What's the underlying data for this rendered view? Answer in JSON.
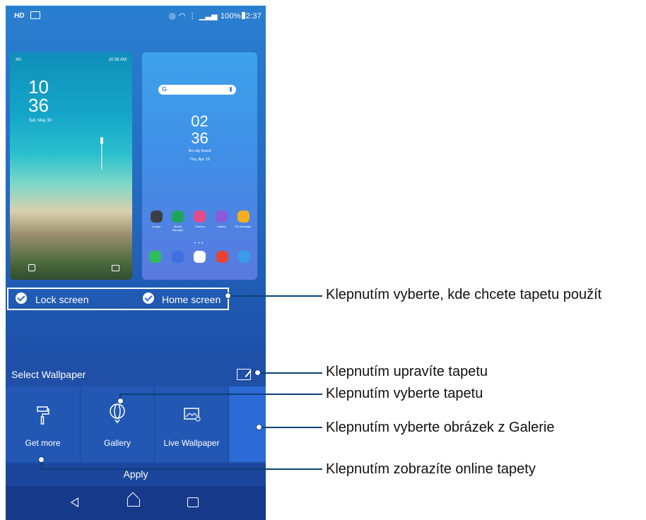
{
  "status_bar": {
    "left_label": "HD",
    "right_text": "100%",
    "time": "2:37"
  },
  "lock_preview": {
    "signal": "4G",
    "time_small": "10:36 AM",
    "clock_hour": "10",
    "clock_min": "36",
    "date": "Sat, May 30"
  },
  "home_preview": {
    "search_logo": "G",
    "clock_hour": "02",
    "clock_min": "36",
    "city": "No city found",
    "date": "Thu, Apr 19",
    "apps": [
      {
        "label": "Google",
        "color": "#3b3f45"
      },
      {
        "label": "Mobile Manager",
        "color": "#1ea45b"
      },
      {
        "label": "Themes",
        "color": "#e84b8a"
      },
      {
        "label": "Gallery",
        "color": "#8a5bd9"
      },
      {
        "label": "File Manager",
        "color": "#f2b01e"
      }
    ],
    "dock": [
      {
        "name": "phone",
        "color": "#2fbf5a"
      },
      {
        "name": "messages",
        "color": "#3f6fe0"
      },
      {
        "name": "play-store",
        "color": "#ffffff"
      },
      {
        "name": "chrome",
        "color": "#e94335"
      },
      {
        "name": "camera",
        "color": "#3b9be8"
      }
    ]
  },
  "targets": {
    "lock": "Lock screen",
    "home": "Home screen"
  },
  "select_wallpaper": "Select Wallpaper",
  "options": [
    {
      "label": "Get more",
      "icon": "paint-roller-icon"
    },
    {
      "label": "Gallery",
      "icon": "balloon-icon"
    },
    {
      "label": "Live Wallpaper",
      "icon": "live-wallpaper-icon"
    }
  ],
  "apply": "Apply",
  "callouts": {
    "c1": "Klepnutím vyberte, kde chcete tapetu použít",
    "c2": "Klepnutím upravíte tapetu",
    "c3": "Klepnutím vyberte tapetu",
    "c4": "Klepnutím vyberte obrázek z Galerie",
    "c5": "Klepnutím zobrazíte online tapety"
  },
  "colors": {
    "accent": "#2258b3",
    "callout_line": "#0a3f78"
  }
}
